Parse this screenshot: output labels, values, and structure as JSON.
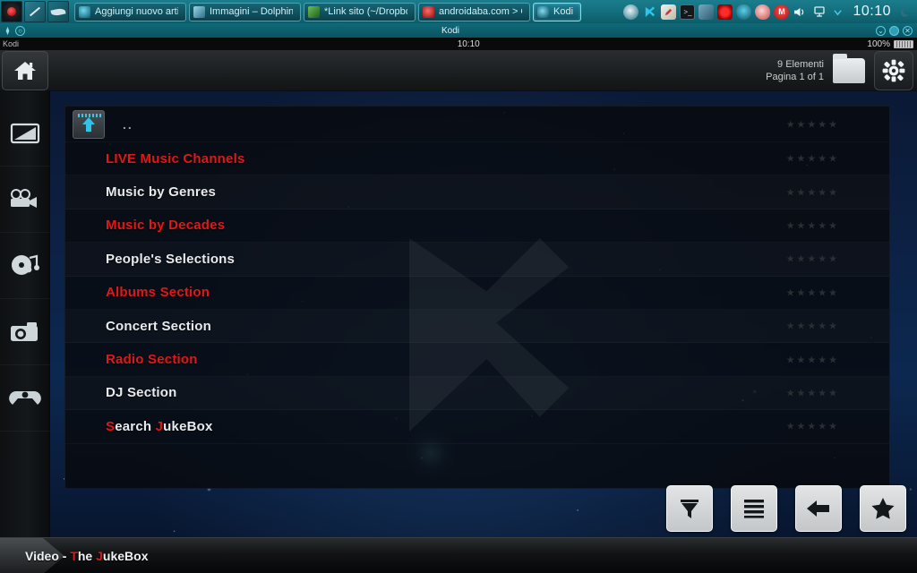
{
  "taskbar": {
    "launchers": [
      {
        "name": "app-launcher-menu",
        "label": "Menu"
      },
      {
        "name": "screenshot-tool",
        "label": "Screenshot"
      },
      {
        "name": "dolphin-file-manager",
        "label": "Dolphin"
      }
    ],
    "tasks": [
      {
        "label": "Aggiungi nuovo artic...",
        "icon": "browser-icon",
        "active": false
      },
      {
        "label": "Immagini – Dolphin",
        "icon": "folder-image-icon",
        "active": false
      },
      {
        "label": "*Link sito (~/Dropbox...",
        "icon": "editor-icon",
        "active": false
      },
      {
        "label": "androidaba.com > G...",
        "icon": "browser-red-icon",
        "active": false
      },
      {
        "label": "Kodi",
        "icon": "kodi-icon",
        "active": true
      }
    ],
    "tray": [
      {
        "name": "dolphin-tray-icon",
        "glyph": ""
      },
      {
        "name": "kodi-tray-icon",
        "glyph": "K"
      },
      {
        "name": "notes-tray-icon",
        "glyph": ""
      },
      {
        "name": "terminal-tray-icon",
        "glyph": ">_"
      },
      {
        "name": "network-tray-icon",
        "glyph": ""
      },
      {
        "name": "recorder-tray-icon",
        "glyph": ""
      },
      {
        "name": "shield-tray-icon",
        "glyph": ""
      },
      {
        "name": "blob-tray-icon",
        "glyph": ""
      },
      {
        "name": "messenger-tray-icon",
        "glyph": "M"
      },
      {
        "name": "volume-tray-icon",
        "glyph": "🔊"
      },
      {
        "name": "display-tray-icon",
        "glyph": "🖵"
      },
      {
        "name": "expand-tray-icon",
        "glyph": "⌄"
      }
    ],
    "clock": "10:10",
    "moon_icon": "night-mode-icon"
  },
  "window": {
    "title": "Kodi",
    "controls": [
      "minimize",
      "maximize",
      "close"
    ]
  },
  "statusbar2": {
    "app_name": "Kodi",
    "time": "10:10",
    "battery": "100%"
  },
  "kodi_header": {
    "home_icon": "home-icon",
    "item_count": "9 Elementi",
    "page_info": "Pagina 1 of 1",
    "view_icon": "folder-view-icon",
    "settings_icon": "gear-icon"
  },
  "sidebar": {
    "items": [
      {
        "name": "sidebar-item-tv",
        "icon": "tv-icon"
      },
      {
        "name": "sidebar-item-movies",
        "icon": "movie-camera-icon"
      },
      {
        "name": "sidebar-item-music",
        "icon": "music-disc-icon"
      },
      {
        "name": "sidebar-item-pictures",
        "icon": "camera-icon"
      },
      {
        "name": "sidebar-item-games",
        "icon": "gamepad-icon"
      }
    ]
  },
  "list": {
    "parent_label": "..",
    "parent_icon": "up-arrow-icon",
    "rating_stars": "★★★★★",
    "items": [
      {
        "label": "LIVE Music Channels",
        "color": "red"
      },
      {
        "label": "Music by Genres",
        "color": "white"
      },
      {
        "label": "Music by Decades",
        "color": "red"
      },
      {
        "label": "People's Selections",
        "color": "white"
      },
      {
        "label": "Albums Section",
        "color": "red"
      },
      {
        "label": "Concert Section",
        "color": "white"
      },
      {
        "label": "Radio Section",
        "color": "red"
      },
      {
        "label": "DJ Section",
        "color": "white"
      },
      {
        "label": "Search JukeBox",
        "color": "mixed",
        "parts": [
          {
            "t": "S",
            "c": "red"
          },
          {
            "t": "earch ",
            "c": "white"
          },
          {
            "t": "J",
            "c": "red"
          },
          {
            "t": "ukeBox",
            "c": "white"
          }
        ]
      }
    ]
  },
  "bottom": {
    "breadcrumb_parts": [
      {
        "t": "Video - ",
        "c": "white"
      },
      {
        "t": "T",
        "c": "red"
      },
      {
        "t": "he ",
        "c": "white"
      },
      {
        "t": "J",
        "c": "red"
      },
      {
        "t": "ukeBox",
        "c": "white"
      }
    ],
    "buttons": [
      {
        "name": "filter-button",
        "icon": "funnel-icon"
      },
      {
        "name": "list-view-button",
        "icon": "list-icon"
      },
      {
        "name": "back-button",
        "icon": "back-arrow-icon"
      },
      {
        "name": "favourites-button",
        "icon": "star-icon"
      }
    ]
  },
  "colors": {
    "accent_red": "#e21818",
    "taskbar_teal": "#14707f",
    "text_white": "#e8eaec"
  }
}
